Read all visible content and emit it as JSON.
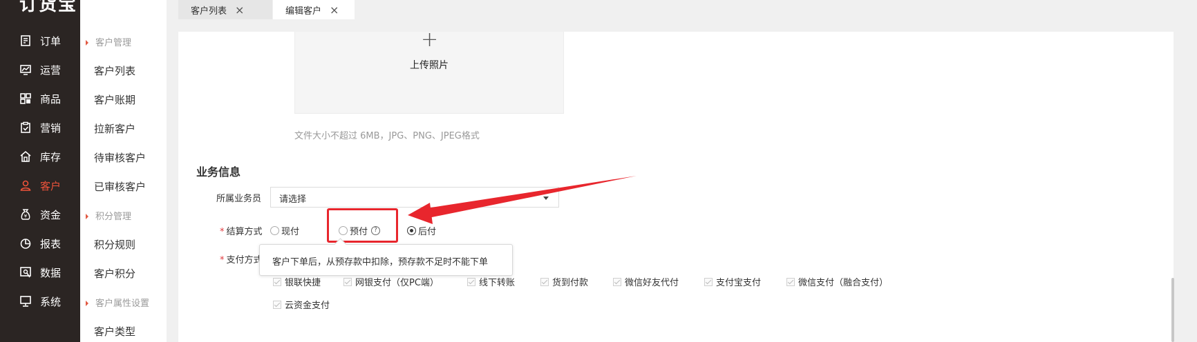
{
  "app": {
    "logo": "订货宝"
  },
  "nav": [
    {
      "label": "订单",
      "icon": "order-icon"
    },
    {
      "label": "运营",
      "icon": "operation-chart-icon"
    },
    {
      "label": "商品",
      "icon": "goods-grid-icon"
    },
    {
      "label": "营销",
      "icon": "marketing-clipboard-icon"
    },
    {
      "label": "库存",
      "icon": "warehouse-icon"
    },
    {
      "label": "客户",
      "icon": "customer-person-icon",
      "active": true
    },
    {
      "label": "资金",
      "icon": "money-bag-icon"
    },
    {
      "label": "报表",
      "icon": "pie-chart-icon"
    },
    {
      "label": "数据",
      "icon": "data-search-icon"
    },
    {
      "label": "系统",
      "icon": "monitor-icon"
    }
  ],
  "subnav": {
    "group1": "客户管理",
    "items1": [
      "客户列表",
      "客户账期",
      "拉新客户",
      "待审核客户",
      "已审核客户"
    ],
    "group2": "积分管理",
    "items2": [
      "积分规则",
      "客户积分"
    ],
    "group3": "客户属性设置",
    "items3": [
      "客户类型"
    ]
  },
  "tabs": [
    {
      "label": "客户列表",
      "close": "×"
    },
    {
      "label": "编辑客户",
      "close": "×",
      "active": true
    }
  ],
  "upload": {
    "plus": "+",
    "label": "上传照片",
    "hint": "文件大小不超过 6MB，JPG、PNG、JPEG格式"
  },
  "business": {
    "title": "业务信息",
    "salesperson_label": "所属业务员",
    "salesperson_value": "请选择",
    "settlement_label": "结算方式",
    "required_mark": "*",
    "settlement_options": [
      {
        "label": "现付",
        "checked": false
      },
      {
        "label": "预付",
        "checked": false,
        "help": "?"
      },
      {
        "label": "后付",
        "checked": true
      }
    ],
    "tooltip": "客户下单后，从预存款中扣除，预存款不足时不能下单",
    "payment_label": "支付方式",
    "payment_options": [
      "银联快捷",
      "网银支付（仅PC端）",
      "线下转账",
      "货到付款",
      "微信好友代付",
      "支付宝支付",
      "微信支付（融合支付）",
      "云资金支付"
    ]
  },
  "colors": {
    "sidebar": "#2b2523",
    "accent": "#f0533a",
    "highlight": "#e8262d"
  }
}
